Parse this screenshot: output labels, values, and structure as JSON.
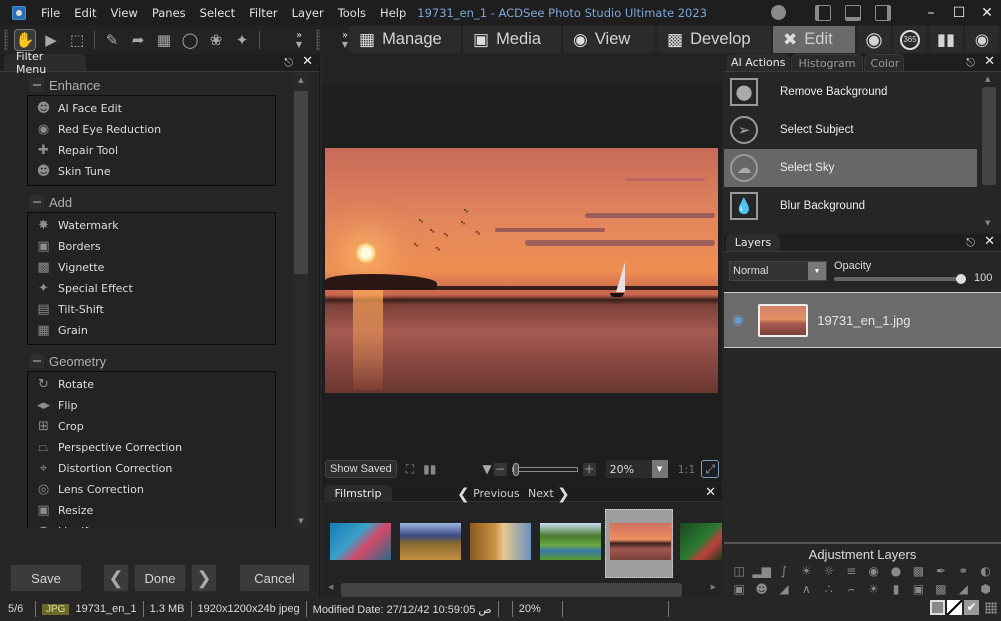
{
  "window": {
    "title": "19731_en_1 - ACDSee Photo Studio Ultimate 2023"
  },
  "menu": [
    "File",
    "Edit",
    "View",
    "Panes",
    "Select",
    "Filter",
    "Layer",
    "Tools",
    "Help"
  ],
  "modes": [
    {
      "label": "Manage",
      "icon": "grid-icon"
    },
    {
      "label": "Media",
      "icon": "media-icon"
    },
    {
      "label": "View",
      "icon": "eye-icon"
    },
    {
      "label": "Develop",
      "icon": "develop-icon"
    },
    {
      "label": "Edit",
      "icon": "edit-icon",
      "active": true
    }
  ],
  "mode_icons": [
    "people-icon",
    "365-icon",
    "dashboard-icon",
    "private-icon"
  ],
  "mode_365": "365",
  "filter_panel": {
    "tab": "Filter Menu",
    "groups": [
      {
        "title": "Enhance",
        "items": [
          "AI Face Edit",
          "Red Eye Reduction",
          "Repair Tool",
          "Skin Tune"
        ]
      },
      {
        "title": "Add",
        "items": [
          "Watermark",
          "Borders",
          "Vignette",
          "Special Effect",
          "Tilt-Shift",
          "Grain"
        ]
      },
      {
        "title": "Geometry",
        "items": [
          "Rotate",
          "Flip",
          "Crop",
          "Perspective Correction",
          "Distortion Correction",
          "Lens Correction",
          "Resize",
          "Liquify"
        ]
      }
    ],
    "buttons": {
      "save": "Save",
      "prev": "<",
      "done": "Done",
      "next": ">",
      "cancel": "Cancel"
    }
  },
  "viewer": {
    "show_saved": "Show Saved",
    "zoom_value": "20%",
    "zoom_slider_fraction": 0.0,
    "one_to_one": "1:1"
  },
  "filmstrip": {
    "tab": "Filmstrip",
    "previous": "Previous",
    "next": "Next",
    "thumbnails": [
      "coral-reef",
      "hay-bales-mountains",
      "autumn-river",
      "green-stream",
      "sunset-lake",
      "flowers"
    ],
    "selected_index": 4
  },
  "right_panel": {
    "tabs": [
      "AI Actions",
      "Histogram",
      "Color"
    ],
    "ai_actions": [
      {
        "label": "Remove Background",
        "icon": "remove-background-icon"
      },
      {
        "label": "Select Subject",
        "icon": "select-subject-icon"
      },
      {
        "label": "Select Sky",
        "icon": "select-sky-icon",
        "selected": true
      },
      {
        "label": "Blur Background",
        "icon": "blur-background-icon"
      }
    ]
  },
  "layers": {
    "tab": "Layers",
    "blend_mode": "Normal",
    "opacity_label": "Opacity",
    "opacity_value": "100",
    "layer_name": "19731_en_1.jpg"
  },
  "adjustment_layers": {
    "title": "Adjustment Layers",
    "row1": [
      "exposure",
      "levels",
      "curves",
      "light-eq",
      "dehaze",
      "sliders",
      "color-palette",
      "color-balance",
      "color-lut",
      "eyedropper",
      "blend",
      "contrast"
    ],
    "row2": [
      "photo",
      "face",
      "tone",
      "pyramid",
      "noise",
      "vignette",
      "sunrise",
      "gradient",
      "radial",
      "linear",
      "split",
      "cube"
    ]
  },
  "status": {
    "index": "5/6",
    "format": "JPG",
    "filename": "19731_en_1",
    "size": "1.3 MB",
    "dimensions": "1920x1200x24b jpeg",
    "modified": "Modified Date: 27/12/42 10:59:05 ص",
    "zoom": "20%"
  }
}
